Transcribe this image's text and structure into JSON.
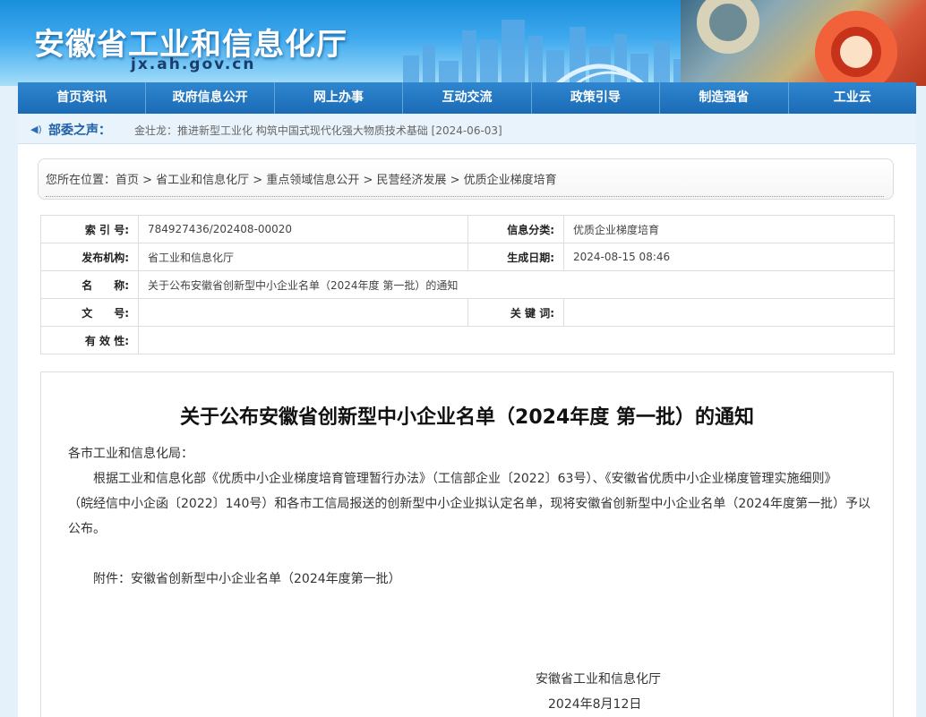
{
  "header": {
    "title": "安徽省工业和信息化厅",
    "domain": "jx.ah.gov.cn"
  },
  "nav": {
    "items": [
      "首页资讯",
      "政府信息公开",
      "网上办事",
      "互动交流",
      "政策引导",
      "制造强省",
      "工业云"
    ]
  },
  "ticker": {
    "label": "部委之声：",
    "news": "金壮龙：推进新型工业化 构筑中国式现代化强大物质技术基础 [2024-06-03]"
  },
  "breadcrumb": {
    "text": "您所在位置：首页 > 省工业和信息化厅 > 重点领域信息公开 > 民营经济发展 > 优质企业梯度培育"
  },
  "meta": {
    "index_label": "索 引 号:",
    "index_value": "784927436/202408-00020",
    "category_label": "信息分类:",
    "category_value": "优质企业梯度培育",
    "publisher_label": "发布机构:",
    "publisher_value": "省工业和信息化厅",
    "date_label": "生成日期:",
    "date_value": "2024-08-15 08:46",
    "name_label": "名　　称:",
    "name_value": "关于公布安徽省创新型中小企业名单（2024年度 第一批）的通知",
    "docno_label": "文　　号:",
    "docno_value": "",
    "keywords_label": "关 键 词:",
    "keywords_value": "",
    "validity_label": "有 效 性:",
    "validity_value": ""
  },
  "article": {
    "title": "关于公布安徽省创新型中小企业名单（2024年度 第一批）的通知",
    "greeting": "各市工业和信息化局：",
    "para_line1": "根据工业和信息化部《优质中小企业梯度培育管理暂行办法》（工信部企业〔2022〕63号）、《安徽省优质中小企业梯度管理实施细则》",
    "para_line2": "（皖经信中小企函〔2022〕140号）和各市工信局报送的创新型中小企业拟认定名单，现将安徽省创新型中小企业名单（2024年度第一批）予以",
    "para_line3": "公布。",
    "attachment": "附件：安徽省创新型中小企业名单（2024年度第一批）",
    "signer": "安徽省工业和信息化厅",
    "sign_date": "2024年8月12日"
  }
}
